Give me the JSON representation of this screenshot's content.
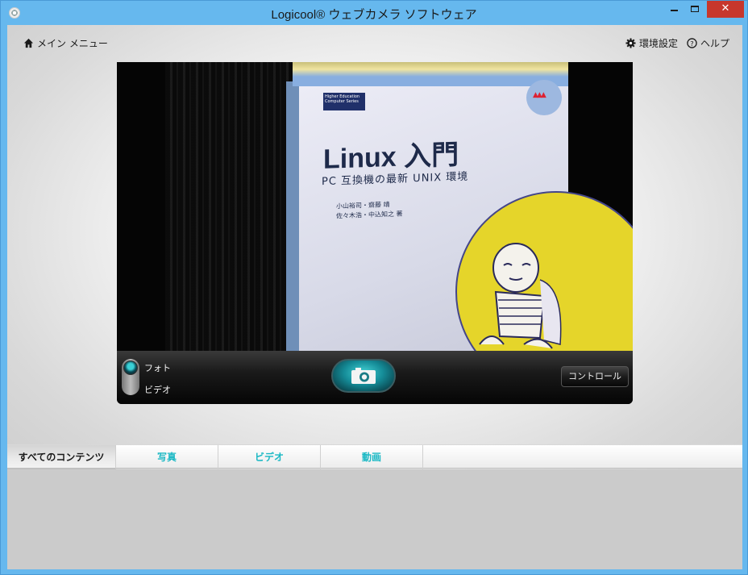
{
  "window": {
    "title": "Logicool® ウェブカメラ ソフトウェア",
    "close_label": "✕"
  },
  "nav": {
    "main_menu": "メイン メニュー",
    "settings": "環境設定",
    "help": "ヘルプ"
  },
  "preview": {
    "book_badge": "Higher Education Computer Series",
    "book_title": "Linux 入門",
    "book_subtitle": "PC 互換機の最新 UNIX 環境",
    "book_authors_line1": "小山裕司・齋藤 靖",
    "book_authors_line2": "佐々木浩・中込知之 著"
  },
  "controls": {
    "mode_photo": "フォト",
    "mode_video": "ビデオ",
    "control_button": "コントロール"
  },
  "tabs": {
    "all": "すべてのコンテンツ",
    "photos": "写真",
    "videos": "ビデオ",
    "movies": "動画"
  },
  "colors": {
    "accent": "#1bb8c4",
    "titlebar": "#66b8ee",
    "close": "#c7372d"
  }
}
